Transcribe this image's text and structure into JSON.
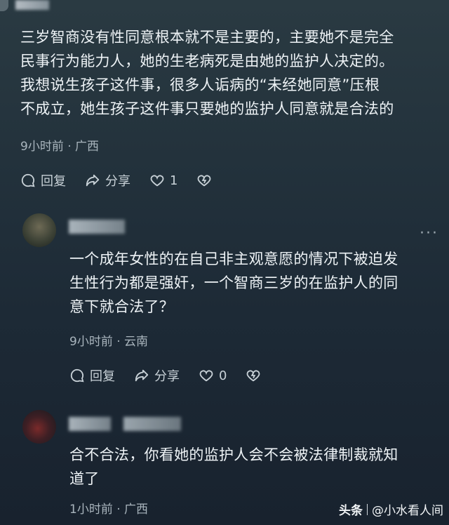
{
  "comment_main": {
    "lines": [
      "三岁智商没有性同意根本就不是主要的，主要她不是完全",
      "民事行为能力人，她的生老病死是由她的监护人决定的。",
      "我想说生孩子这件事，很多人诟病的“未经她同意”压根",
      "不成立，她生孩子这件事只要她的监护人同意就是合法的"
    ],
    "time": "9小时前",
    "dot": "·",
    "location": "广西",
    "reply_label": "回复",
    "share_label": "分享",
    "like_count": "1",
    "icons": [
      "comment-icon",
      "share-icon",
      "heart-icon",
      "dislike-heart-icon"
    ]
  },
  "reply_1": {
    "lines": [
      "一个成年女性的在自己非主观意愿的情况下被迫发",
      "生性行为都是强奸，一个智商三岁的在监护人的同",
      "意下就合法了？"
    ],
    "time": "9小时前",
    "dot": "·",
    "location": "云南",
    "reply_label": "回复",
    "share_label": "分享",
    "like_count": "0",
    "more": "···"
  },
  "reply_2": {
    "lines": [
      "合不合法，你看她的监护人会不会被法律制裁就知",
      "道了"
    ],
    "time": "1小时前",
    "dot": "·",
    "location": "广西"
  },
  "watermark": {
    "brand": "头条",
    "author": "@小水看人间"
  },
  "colors": {
    "background_top": "#2a3a42",
    "background_bottom": "#18222e",
    "text": "#eef3f6",
    "meta": "#a9b5bd"
  }
}
